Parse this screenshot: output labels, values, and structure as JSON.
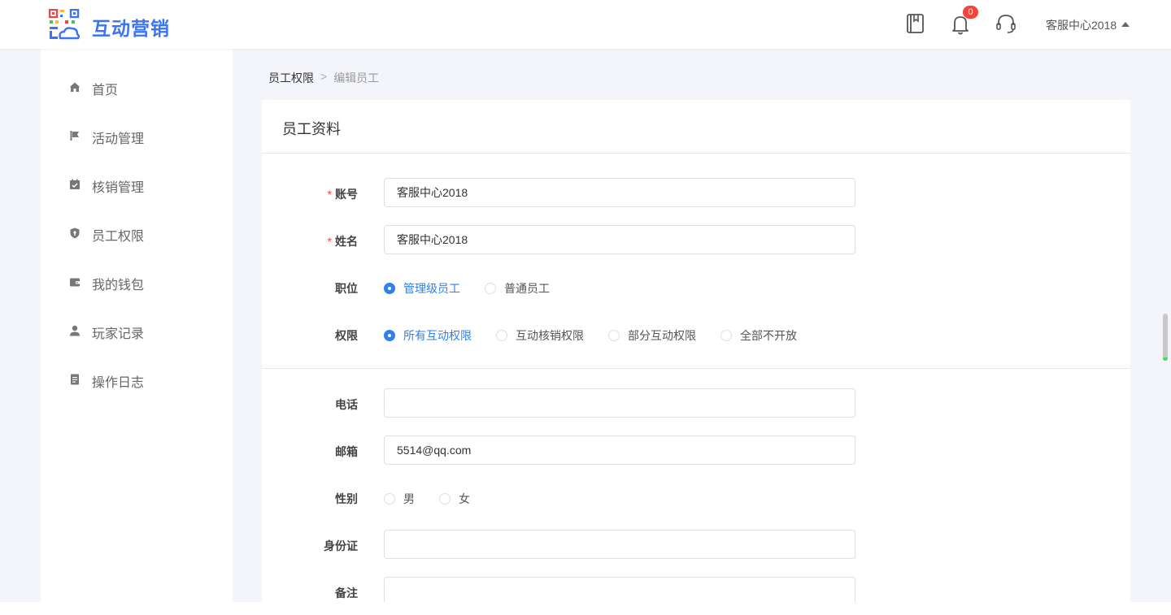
{
  "header": {
    "brand": "互动营销",
    "notification_count": "0",
    "user_name": "客服中心2018"
  },
  "sidebar": {
    "items": [
      {
        "label": "首页",
        "icon": "home-icon"
      },
      {
        "label": "活动管理",
        "icon": "flag-icon"
      },
      {
        "label": "核销管理",
        "icon": "calendar-check-icon"
      },
      {
        "label": "员工权限",
        "icon": "shield-icon"
      },
      {
        "label": "我的钱包",
        "icon": "wallet-icon"
      },
      {
        "label": "玩家记录",
        "icon": "user-icon"
      },
      {
        "label": "操作日志",
        "icon": "document-icon"
      }
    ]
  },
  "breadcrumb": {
    "parent": "员工权限",
    "separator": ">",
    "current": "编辑员工"
  },
  "form": {
    "title": "员工资料",
    "account": {
      "label": "账号",
      "value": "客服中心2018"
    },
    "name": {
      "label": "姓名",
      "value": "客服中心2018"
    },
    "position": {
      "label": "职位",
      "options": [
        "管理级员工",
        "普通员工"
      ],
      "selected": "管理级员工"
    },
    "permission": {
      "label": "权限",
      "options": [
        "所有互动权限",
        "互动核销权限",
        "部分互动权限",
        "全部不开放"
      ],
      "selected": "所有互动权限"
    },
    "phone": {
      "label": "电话",
      "value": ""
    },
    "email": {
      "label": "邮箱",
      "value": "5514@qq.com"
    },
    "gender": {
      "label": "性别",
      "options": [
        "男",
        "女"
      ],
      "selected": ""
    },
    "id_card": {
      "label": "身份证",
      "value": ""
    },
    "remark": {
      "label": "备注",
      "value": ""
    }
  },
  "colors": {
    "accent": "#2f80ed",
    "brand": "#3a74f0",
    "required": "#f5443b",
    "page_bg": "#f4f5fa"
  }
}
